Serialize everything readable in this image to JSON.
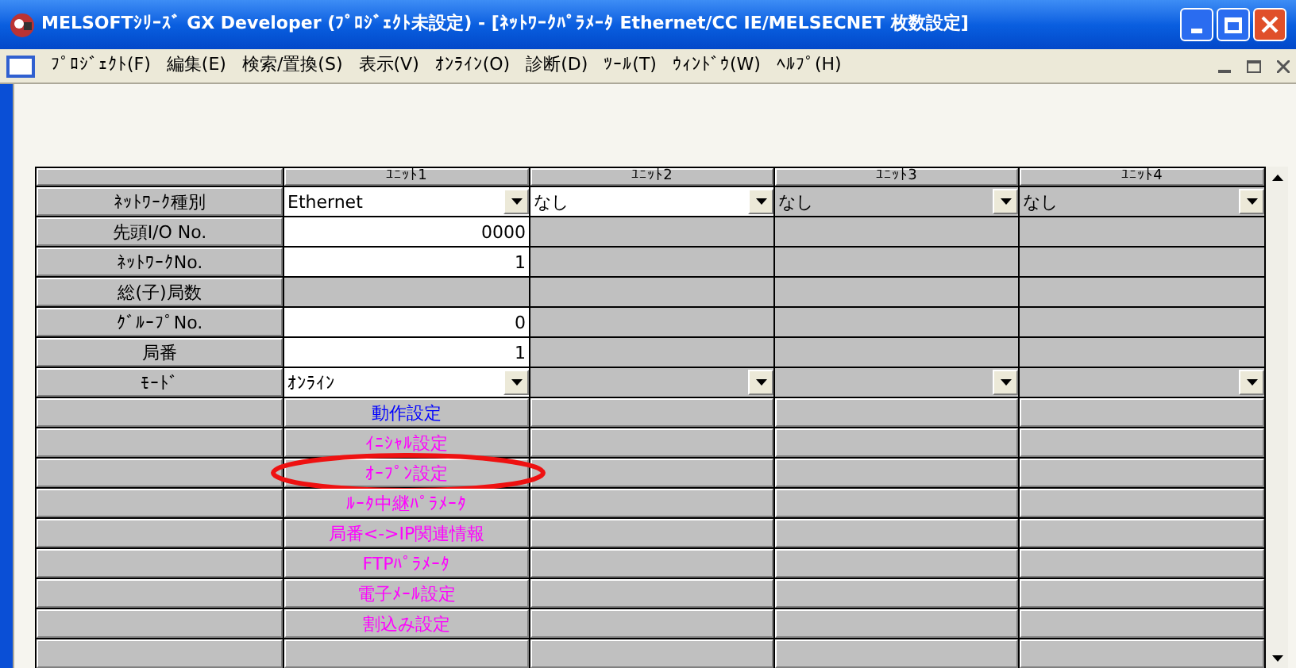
{
  "window": {
    "title": "MELSOFTｼﾘｰｽﾞ GX Developer (ﾌﾟﾛｼﾞｪｸﾄ未設定) - [ﾈｯﾄﾜｰｸﾊﾟﾗﾒｰﾀ Ethernet/CC IE/MELSECNET 枚数設定]"
  },
  "menu": [
    "ﾌﾟﾛｼﾞｪｸﾄ(F)",
    "編集(E)",
    "検索/置換(S)",
    "表示(V)",
    "ｵﾝﾗｲﾝ(O)",
    "診断(D)",
    "ﾂｰﾙ(T)",
    "ｳｨﾝﾄﾞｳ(W)",
    "ﾍﾙﾌﾟ(H)"
  ],
  "table": {
    "columns": [
      "ﾕﾆｯﾄ1",
      "ﾕﾆｯﾄ2",
      "ﾕﾆｯﾄ3",
      "ﾕﾆｯﾄ4"
    ],
    "rows": [
      {
        "label": "ﾈｯﾄﾜｰｸ種別",
        "cells": [
          {
            "kind": "dropdown",
            "value": "Ethernet",
            "enabled": true
          },
          {
            "kind": "dropdown",
            "value": "なし",
            "enabled": true
          },
          {
            "kind": "dropdown",
            "value": "なし",
            "enabled": false
          },
          {
            "kind": "dropdown",
            "value": "なし",
            "enabled": false
          }
        ]
      },
      {
        "label": "先頭I/O No.",
        "cells": [
          {
            "kind": "text",
            "value": "0000"
          },
          {
            "kind": "blank"
          },
          {
            "kind": "blank"
          },
          {
            "kind": "blank"
          }
        ]
      },
      {
        "label": "ﾈｯﾄﾜｰｸNo.",
        "cells": [
          {
            "kind": "text",
            "value": "1"
          },
          {
            "kind": "blank"
          },
          {
            "kind": "blank"
          },
          {
            "kind": "blank"
          }
        ]
      },
      {
        "label": "総(子)局数",
        "cells": [
          {
            "kind": "blank"
          },
          {
            "kind": "blank"
          },
          {
            "kind": "blank"
          },
          {
            "kind": "blank"
          }
        ]
      },
      {
        "label": "ｸﾞﾙｰﾌﾟNo.",
        "cells": [
          {
            "kind": "text",
            "value": "0"
          },
          {
            "kind": "blank"
          },
          {
            "kind": "blank"
          },
          {
            "kind": "blank"
          }
        ]
      },
      {
        "label": "局番",
        "cells": [
          {
            "kind": "text",
            "value": "1"
          },
          {
            "kind": "blank"
          },
          {
            "kind": "blank"
          },
          {
            "kind": "blank"
          }
        ]
      },
      {
        "label": "ﾓｰﾄﾞ",
        "cells": [
          {
            "kind": "dropdown",
            "value": "ｵﾝﾗｲﾝ",
            "enabled": true
          },
          {
            "kind": "dropdown",
            "enabled": false
          },
          {
            "kind": "dropdown",
            "enabled": false
          },
          {
            "kind": "dropdown",
            "enabled": false
          }
        ]
      },
      {
        "cells": [
          {
            "kind": "button",
            "value": "動作設定",
            "color": "#0000ff",
            "circled": false
          },
          {
            "kind": "blank-button"
          },
          {
            "kind": "blank-button"
          },
          {
            "kind": "blank-button"
          }
        ]
      },
      {
        "cells": [
          {
            "kind": "button",
            "value": "ｲﾆｼｬﾙ設定",
            "color": "#ff00ff",
            "circled": false
          },
          {
            "kind": "blank-button"
          },
          {
            "kind": "blank-button"
          },
          {
            "kind": "blank-button"
          }
        ]
      },
      {
        "cells": [
          {
            "kind": "button",
            "value": "ｵｰﾌﾟﾝ設定",
            "color": "#ff00ff",
            "circled": true
          },
          {
            "kind": "blank-button"
          },
          {
            "kind": "blank-button"
          },
          {
            "kind": "blank-button"
          }
        ]
      },
      {
        "cells": [
          {
            "kind": "button",
            "value": "ﾙｰﾀ中継ﾊﾟﾗﾒｰﾀ",
            "color": "#ff00ff",
            "circled": false
          },
          {
            "kind": "blank-button"
          },
          {
            "kind": "blank-button"
          },
          {
            "kind": "blank-button"
          }
        ]
      },
      {
        "cells": [
          {
            "kind": "button",
            "value": "局番<->IP関連情報",
            "color": "#ff00ff",
            "circled": false
          },
          {
            "kind": "blank-button"
          },
          {
            "kind": "blank-button"
          },
          {
            "kind": "blank-button"
          }
        ]
      },
      {
        "cells": [
          {
            "kind": "button",
            "value": "FTPﾊﾟﾗﾒｰﾀ",
            "color": "#ff00ff",
            "circled": false
          },
          {
            "kind": "blank-button"
          },
          {
            "kind": "blank-button"
          },
          {
            "kind": "blank-button"
          }
        ]
      },
      {
        "cells": [
          {
            "kind": "button",
            "value": "電子ﾒｰﾙ設定",
            "color": "#ff00ff",
            "circled": false
          },
          {
            "kind": "blank-button"
          },
          {
            "kind": "blank-button"
          },
          {
            "kind": "blank-button"
          }
        ]
      },
      {
        "cells": [
          {
            "kind": "button",
            "value": "割込み設定",
            "color": "#ff00ff",
            "circled": false
          },
          {
            "kind": "blank-button"
          },
          {
            "kind": "blank-button"
          },
          {
            "kind": "blank-button"
          }
        ]
      },
      {
        "cells": [
          {
            "kind": "blank-button"
          },
          {
            "kind": "blank-button"
          },
          {
            "kind": "blank-button"
          },
          {
            "kind": "blank-button"
          }
        ]
      }
    ]
  }
}
